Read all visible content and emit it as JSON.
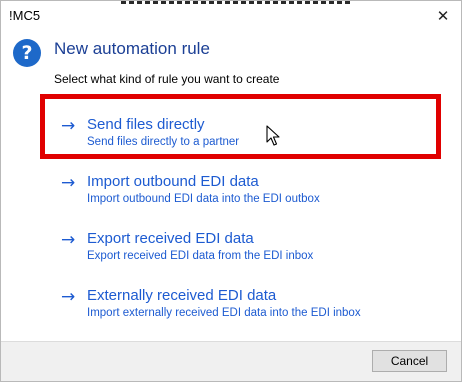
{
  "window": {
    "title": "!MC5",
    "close_glyph": "✕"
  },
  "header": {
    "icon": "question-icon",
    "icon_glyph": "?",
    "title": "New automation rule",
    "instruction": "Select what kind of rule you want to create"
  },
  "options": [
    {
      "arrow": "→",
      "title": "Send files directly",
      "description": "Send files directly to a partner"
    },
    {
      "arrow": "→",
      "title": "Import outbound EDI data",
      "description": "Import outbound EDI data into the EDI outbox"
    },
    {
      "arrow": "→",
      "title": "Export received EDI data",
      "description": "Export received EDI data from the EDI inbox"
    },
    {
      "arrow": "→",
      "title": "Externally received EDI data",
      "description": "Import externally received EDI data into the EDI inbox"
    }
  ],
  "footer": {
    "cancel_label": "Cancel"
  },
  "colors": {
    "accent_link": "#1d5bd1",
    "header_title": "#1b3f95",
    "highlight": "#e00000",
    "help_icon": "#1e69c9"
  }
}
